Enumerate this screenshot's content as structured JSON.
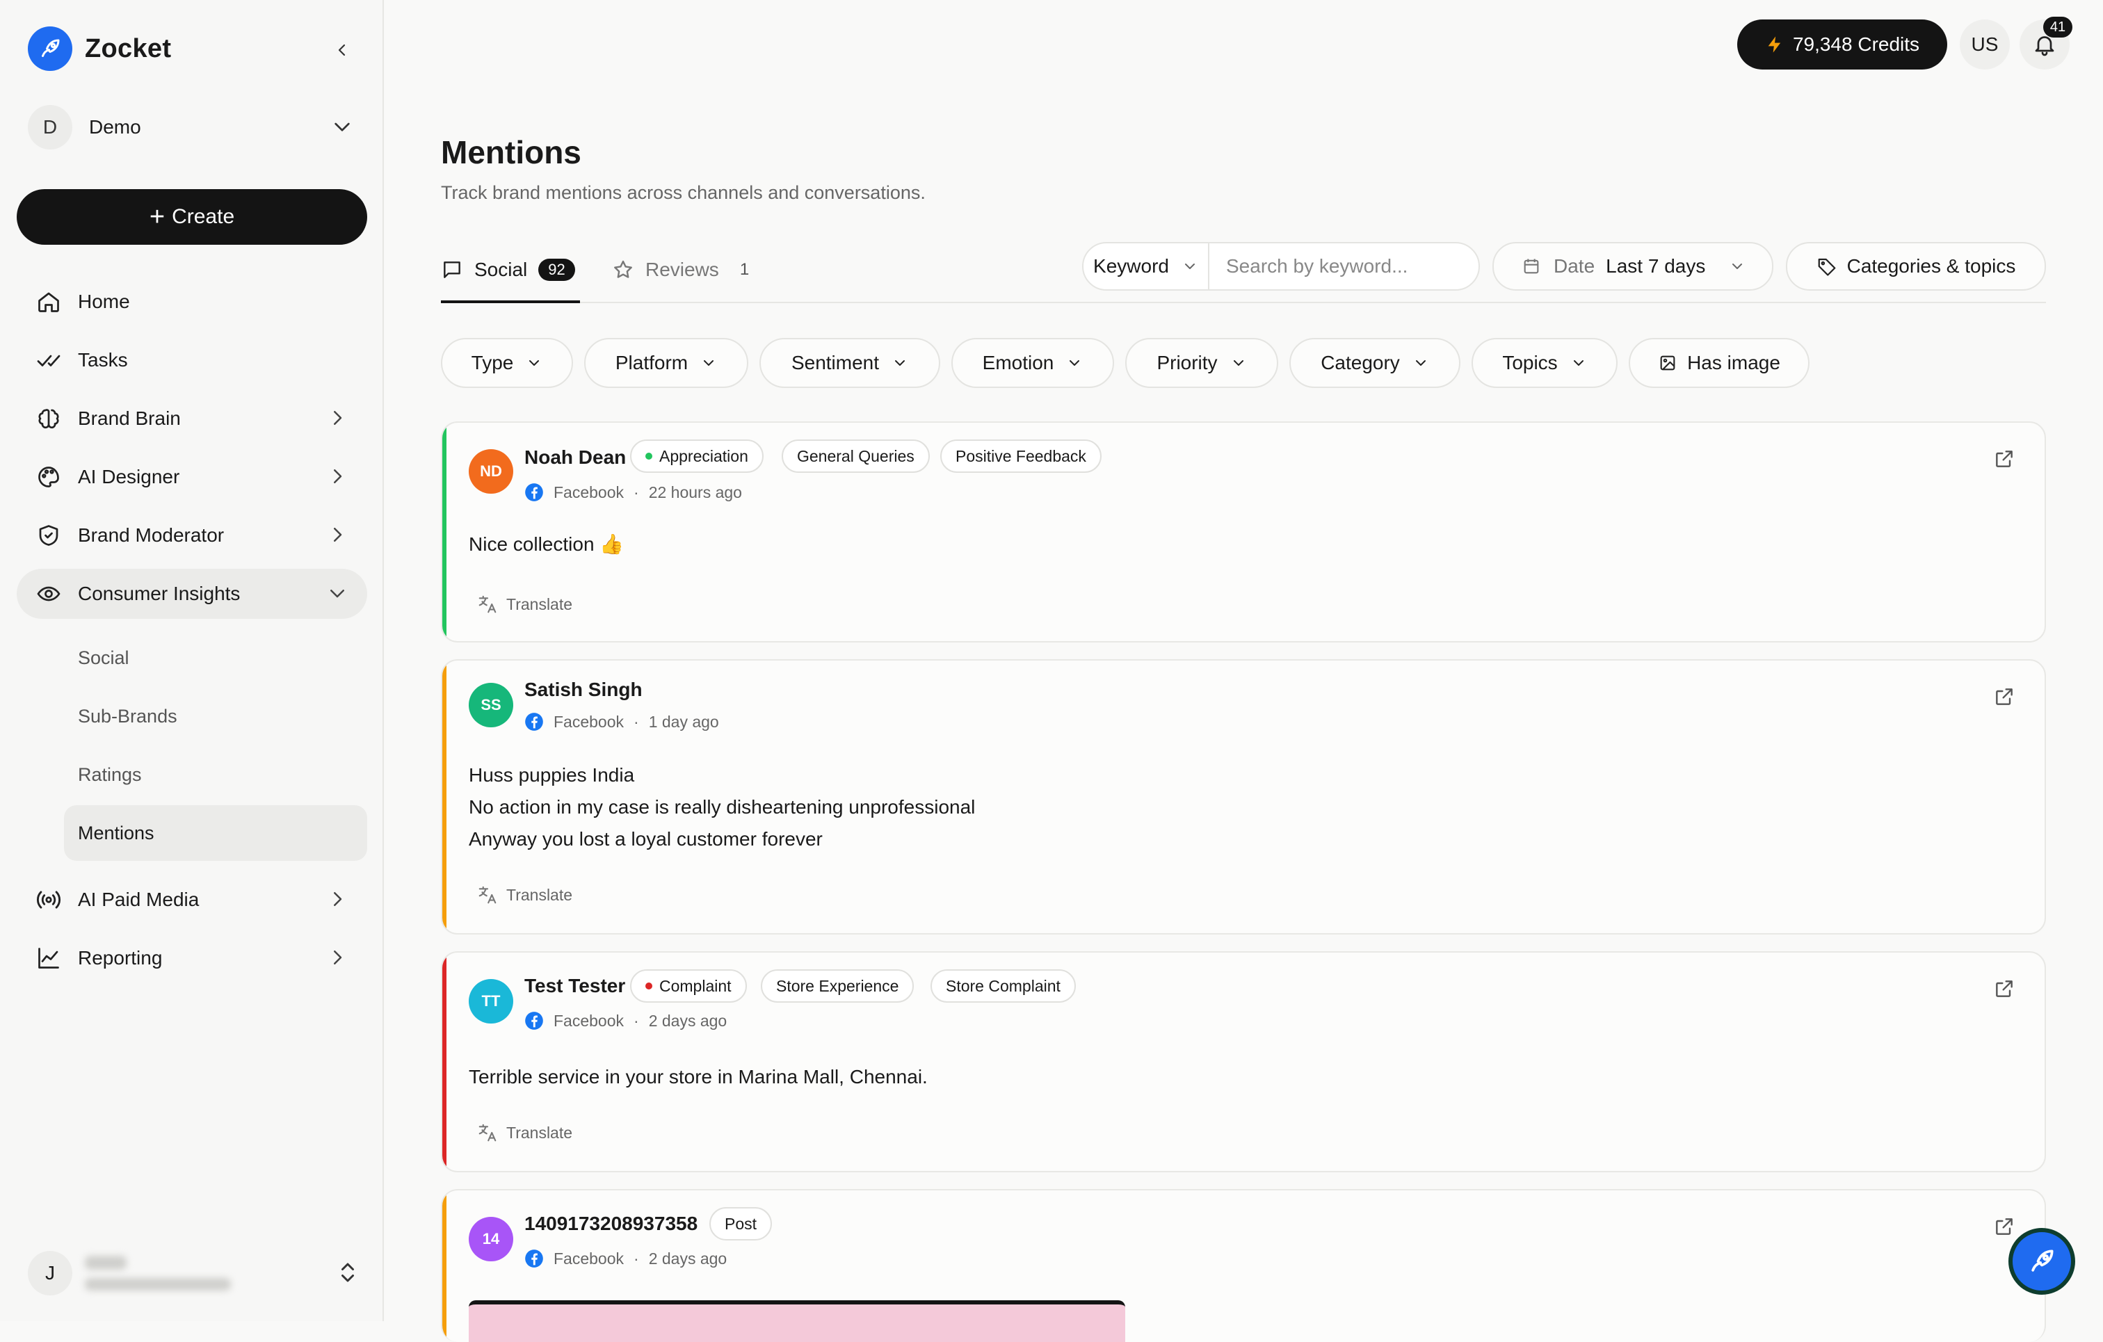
{
  "app": {
    "brand": "Zocket"
  },
  "workspace": {
    "initial": "D",
    "name": "Demo"
  },
  "sidebar": {
    "create_label": "Create",
    "items": [
      {
        "label": "Home",
        "icon": "home-icon"
      },
      {
        "label": "Tasks",
        "icon": "tasks-icon"
      },
      {
        "label": "Brand Brain",
        "icon": "brain-icon"
      },
      {
        "label": "AI Designer",
        "icon": "palette-icon"
      },
      {
        "label": "Brand Moderator",
        "icon": "shield-icon"
      },
      {
        "label": "Consumer Insights",
        "icon": "eye-icon"
      },
      {
        "label": "AI Paid Media",
        "icon": "broadcast-icon"
      },
      {
        "label": "Reporting",
        "icon": "chart-line-icon"
      }
    ],
    "sub_items": [
      {
        "label": "Social"
      },
      {
        "label": "Sub-Brands"
      },
      {
        "label": "Ratings"
      },
      {
        "label": "Mentions"
      }
    ]
  },
  "user": {
    "initial": "J"
  },
  "topbar": {
    "credits": "79,348 Credits",
    "region": "US",
    "notifications_count": "41"
  },
  "page": {
    "title": "Mentions",
    "subtitle": "Track brand mentions across channels and conversations."
  },
  "tabs": [
    {
      "label": "Social",
      "count": "92",
      "active": true
    },
    {
      "label": "Reviews",
      "count": "1",
      "active": false
    }
  ],
  "search": {
    "mode_label": "Keyword",
    "placeholder": "Search by keyword..."
  },
  "date_filter": {
    "label": "Date",
    "value": "Last 7 days"
  },
  "categories_button": "Categories & topics",
  "filters": [
    {
      "label": "Type"
    },
    {
      "label": "Platform"
    },
    {
      "label": "Sentiment"
    },
    {
      "label": "Emotion"
    },
    {
      "label": "Priority"
    },
    {
      "label": "Category"
    },
    {
      "label": "Topics"
    },
    {
      "label": "Has image"
    }
  ],
  "mentions": [
    {
      "initials": "ND",
      "avatar_color": "#f26b1d",
      "accent_color": "#22c55e",
      "name": "Noah Dean",
      "tags": [
        {
          "label": "Appreciation",
          "dot": "#22c55e"
        },
        {
          "label": "General Queries"
        },
        {
          "label": "Positive Feedback"
        }
      ],
      "platform": "Facebook",
      "time": "22 hours ago",
      "text": [
        "Nice collection 👍"
      ],
      "translate": "Translate"
    },
    {
      "initials": "SS",
      "avatar_color": "#16b77a",
      "accent_color": "#f59e0b",
      "name": "Satish Singh",
      "tags": [],
      "platform": "Facebook",
      "time": "1 day ago",
      "text": [
        "Huss puppies India",
        "No action in my case is really disheartening unprofessional",
        "Anyway you lost a loyal customer forever"
      ],
      "translate": "Translate"
    },
    {
      "initials": "TT",
      "avatar_color": "#1ab8d8",
      "accent_color": "#dc2626",
      "name": "Test Tester",
      "tags": [
        {
          "label": "Complaint",
          "dot": "#dc2626"
        },
        {
          "label": "Store Experience"
        },
        {
          "label": "Store Complaint"
        }
      ],
      "platform": "Facebook",
      "time": "2 days ago",
      "text": [
        "Terrible service in your store in Marina Mall, Chennai."
      ],
      "translate": "Translate"
    },
    {
      "initials": "14",
      "avatar_color": "#a855f7",
      "accent_color": "#f59e0b",
      "name": "1409173208937358",
      "tags": [
        {
          "label": "Post"
        }
      ],
      "platform": "Facebook",
      "time": "2 days ago",
      "text": [],
      "translate": ""
    }
  ],
  "colors": {
    "brand_blue": "#1f6bf0",
    "dark": "#141414",
    "facebook_blue": "#1877f2"
  }
}
